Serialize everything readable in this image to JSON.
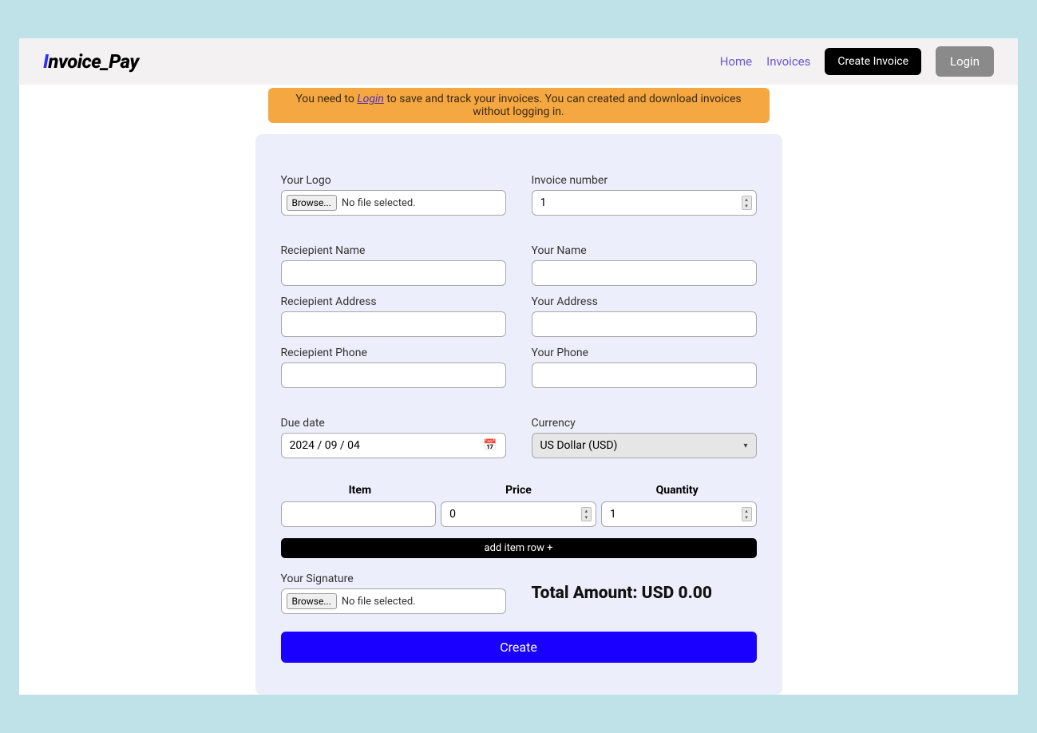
{
  "brand": {
    "accent": "I",
    "rest": "nvoice_Pay"
  },
  "nav": {
    "home": "Home",
    "invoices": "Invoices",
    "create_invoice": "Create Invoice",
    "login": "Login"
  },
  "alert": {
    "before": "You need to ",
    "login": "Login",
    "after": " to save and track your invoices. You can created and download invoices without logging in."
  },
  "labels": {
    "your_logo": "Your Logo",
    "invoice_number": "Invoice number",
    "recipient_name": "Reciepient Name",
    "your_name": "Your Name",
    "recipient_address": "Reciepient Address",
    "your_address": "Your Address",
    "recipient_phone": "Reciepient Phone",
    "your_phone": "Your Phone",
    "due_date": "Due date",
    "currency": "Currency",
    "item": "Item",
    "price": "Price",
    "quantity": "Quantity",
    "your_signature": "Your Signature"
  },
  "file": {
    "browse": "Browse...",
    "none": "No file selected."
  },
  "values": {
    "invoice_number": "1",
    "due_date": "2024 / 09 / 04",
    "currency_display": "US Dollar (USD)",
    "price": "0",
    "quantity": "1",
    "item": ""
  },
  "add_row": "add item row +",
  "total_label": "Total Amount: USD 0.00",
  "create": "Create"
}
